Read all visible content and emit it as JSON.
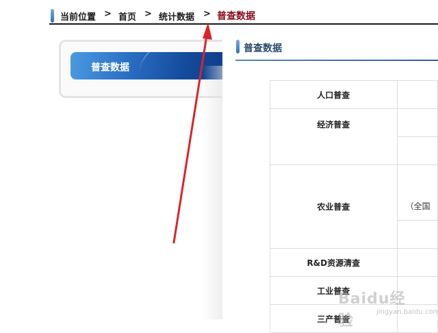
{
  "breadcrumb": {
    "location_label": "当前位置",
    "separator": ">",
    "items": [
      "首页",
      "统计数据",
      "普查数据"
    ]
  },
  "left_nav": {
    "active_label": "普查数据"
  },
  "section": {
    "title": "普查数据"
  },
  "census_table": {
    "rows": [
      {
        "name": "人口普查",
        "value": ""
      },
      {
        "name": "经济普查",
        "value": ""
      },
      {
        "name": "农业普查",
        "value": "（全国"
      },
      {
        "name": "R&D资源清查",
        "value": ""
      },
      {
        "name": "工业普查",
        "value": ""
      },
      {
        "name": "三产普查",
        "value": ""
      }
    ]
  },
  "watermark": {
    "text": "Baidu经验",
    "sub": "jingyan.baidu.com"
  },
  "colors": {
    "breadcrumb_current": "#8a0f1c",
    "tab_gradient_start": "#4b9be0",
    "tab_gradient_end": "#0e3b86",
    "arrow": "#d9232a",
    "section_title": "#2b4a6b"
  },
  "icons": [
    "breadcrumb-marker-icon",
    "section-marker-icon",
    "chevron-right-icon",
    "red-arrow-annotation-icon"
  ]
}
